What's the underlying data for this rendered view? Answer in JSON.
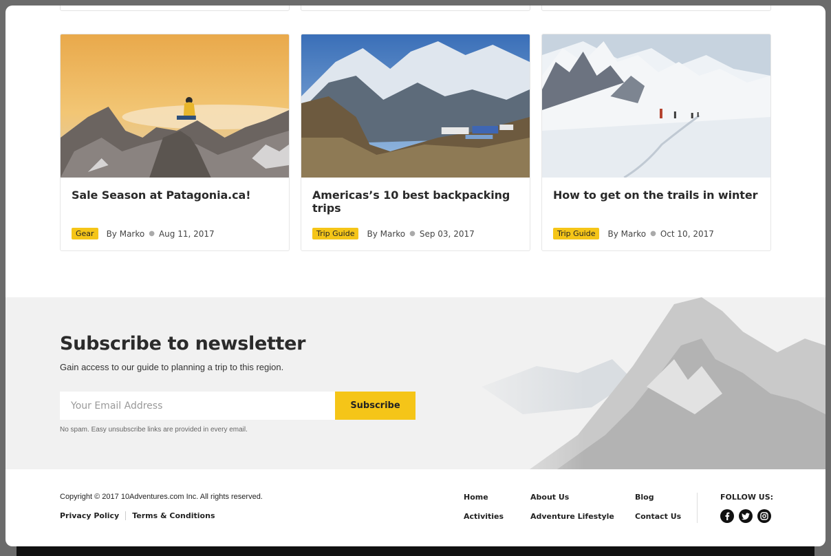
{
  "cards": [
    {
      "title": "Sale Season at Patagonia.ca!",
      "tag": "Gear",
      "author": "By Marko",
      "date": "Aug 11, 2017",
      "image": "hiker-sitting-on-mountain-sunset"
    },
    {
      "title": "Americas’s 10 best backpacking trips",
      "tag": "Trip Guide",
      "author": "By Marko",
      "date": "Sep 03, 2017",
      "image": "mountain-valley-camp"
    },
    {
      "title": "How to get on the trails in winter",
      "tag": "Trip Guide",
      "author": "By Marko",
      "date": "Oct 10, 2017",
      "image": "snow-hikers-trail"
    }
  ],
  "newsletter": {
    "title": "Subscribe to newsletter",
    "subtitle": "Gain access to our guide to planning a trip to this region.",
    "placeholder": "Your Email Address",
    "button": "Subscribe",
    "note": "No spam. Easy unsubscribe links are provided in every email."
  },
  "footer": {
    "copyright": "Copyright © 2017 10Adventures.com Inc. All rights reserved.",
    "privacy": "Privacy Policy",
    "terms": "Terms & Conditions",
    "links": {
      "home": "Home",
      "activities": "Activities",
      "about": "About Us",
      "lifestyle": "Adventure Lifestyle",
      "blog": "Blog",
      "contact": "Contact Us"
    },
    "follow": "FOLLOW US:",
    "social_icons": [
      "facebook-icon",
      "twitter-icon",
      "instagram-icon"
    ]
  },
  "colors": {
    "accent": "#f5c518",
    "newsletter_bg": "#f1f1f1"
  }
}
